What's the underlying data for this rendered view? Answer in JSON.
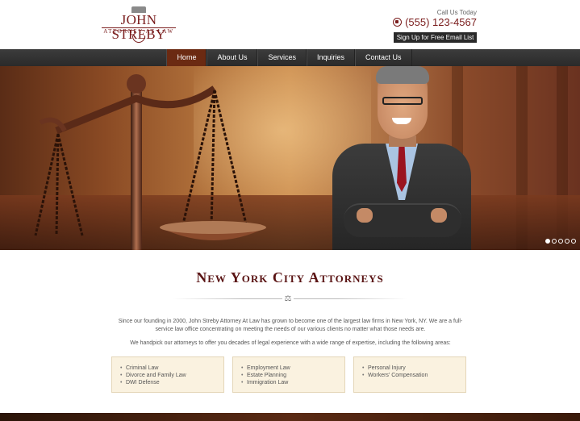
{
  "header": {
    "logo_name": "JOHN STREBY",
    "logo_sub": "ATTORNEY AT LAW",
    "call_label": "Call Us Today",
    "phone": "(555) 123-4567",
    "signup_label": "Sign Up for Free Email List"
  },
  "nav": {
    "items": [
      {
        "label": "Home"
      },
      {
        "label": "About Us"
      },
      {
        "label": "Services"
      },
      {
        "label": "Inquiries"
      },
      {
        "label": "Contact Us"
      }
    ],
    "active": "Home"
  },
  "slider": {
    "slide_count": 5,
    "active_slide": 1
  },
  "main": {
    "heading": "New York City Attorneys",
    "intro": "Since our founding in 2000, John Streby Attorney At Law has grown to become one of the largest law firms in New York, NY. We are a full-service law office concentrating on meeting the needs of our various clients no matter what those needs are.",
    "intro2": "We handpick our attorneys to offer you decades of legal experience with a wide range of expertise, including the following areas:",
    "practice_columns": [
      {
        "items": [
          "Criminal Law",
          "Divorce and Family Law",
          "DWI Defense"
        ]
      },
      {
        "items": [
          "Employment Law",
          "Estate Planning",
          "Immigration Law"
        ]
      },
      {
        "items": [
          "Personal Injury",
          "Workers' Compensation"
        ]
      }
    ]
  },
  "colors": {
    "brand": "#7a1d1d",
    "nav_bg": "#333333",
    "nav_active": "#6b2a12",
    "box_bg": "#faf2e0"
  }
}
